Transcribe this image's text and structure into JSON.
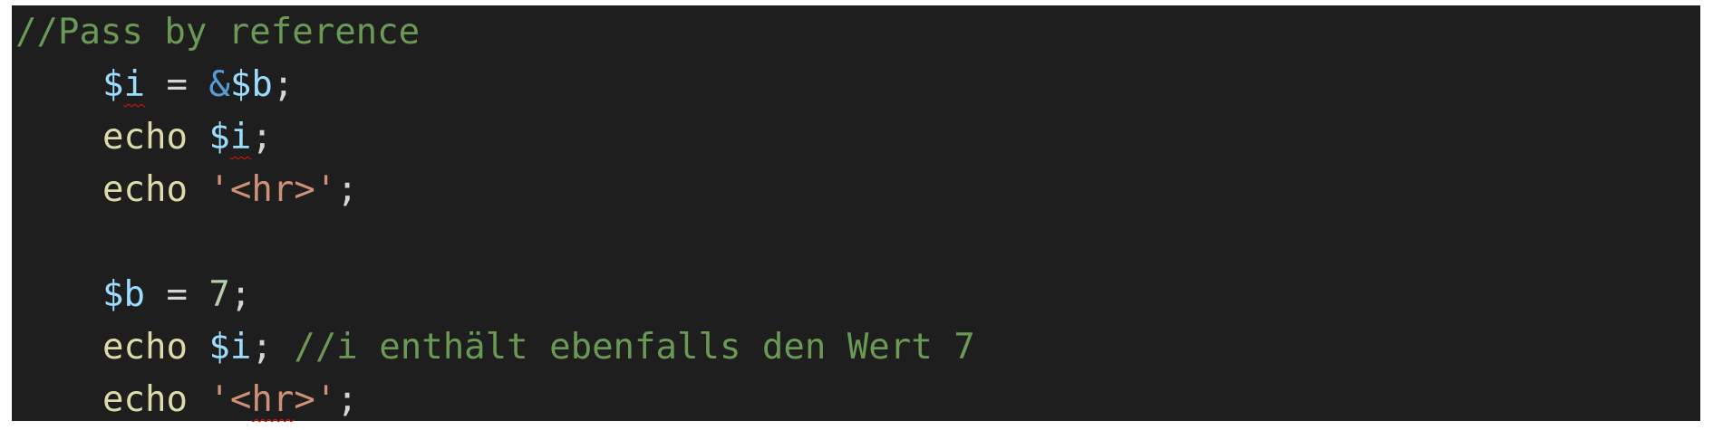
{
  "editor": {
    "lines": [
      {
        "comment": "//Pass by reference"
      },
      {
        "var1_sigil": "$",
        "var1_name": "i",
        "assign": " = ",
        "ref_op": "&",
        "var2": "$b",
        "end": ";"
      },
      {
        "kw": "echo",
        "space": " ",
        "var_sigil": "$",
        "var_name": "i",
        "end": ";"
      },
      {
        "kw": "echo",
        "space": " ",
        "str_quote_open": "'",
        "str_body_a": "<",
        "str_body_b": "hr",
        "str_body_c": ">",
        "str_quote_close": "'",
        "end": ";"
      },
      {
        "blank": ""
      },
      {
        "var": "$b",
        "assign": " = ",
        "num": "7",
        "end": ";"
      },
      {
        "kw": "echo",
        "space": " ",
        "var": "$i",
        "end": ";",
        "space2": " ",
        "comment": "//i enthält ebenfalls den Wert 7"
      },
      {
        "kw": "echo",
        "space": " ",
        "str_quote_open": "'",
        "str_body_a": "<",
        "str_body_b": "hr",
        "str_body_c": ">",
        "str_quote_close": "'",
        "end": ";"
      }
    ]
  },
  "colors": {
    "background": "#1e1e1e",
    "comment": "#6a9955",
    "variable": "#9cdcfe",
    "function": "#dcdcaa",
    "string": "#ce9178",
    "number": "#b5cea8",
    "operator": "#569cd6",
    "squiggle": "#e51400"
  }
}
